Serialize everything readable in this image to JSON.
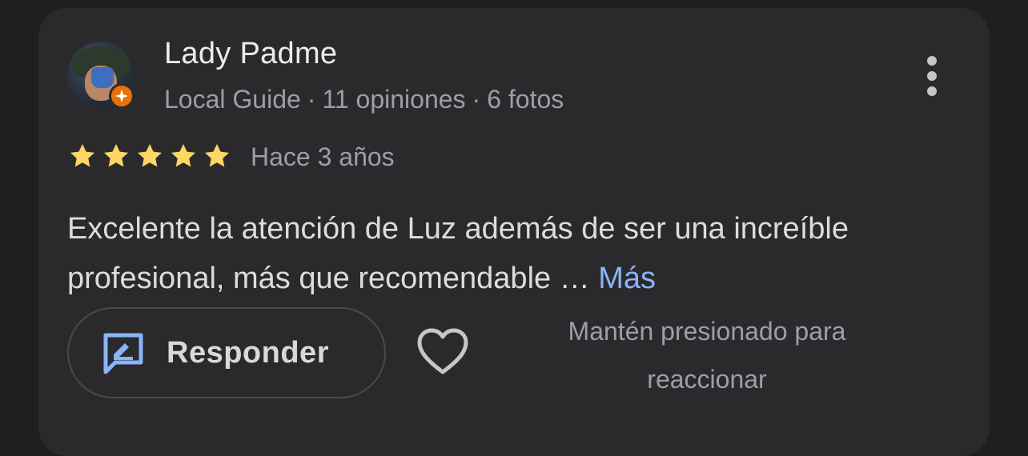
{
  "reviewer": {
    "name": "Lady Padme",
    "badge": "Local Guide",
    "reviews_count": "11 opiniones",
    "photos_count": "6 fotos",
    "separator": "·"
  },
  "rating": {
    "stars": 5,
    "max": 5,
    "color": "#fdd663"
  },
  "review": {
    "time": "Hace 3 años",
    "text_line1": "Excelente la atención de Luz además de ser una increíble",
    "text_line2": "profesional, más que recomendable …",
    "more_link": "Más"
  },
  "actions": {
    "reply_label": "Responder",
    "react_icon": "heart-outline-icon",
    "hint_line1": "Mantén presionado para",
    "hint_line2": "reaccionar"
  },
  "colors": {
    "background": "#1f1f21",
    "card": "#2a2a2d",
    "link": "#8ab4f8",
    "reply_icon": "#8ab4f8",
    "local_guide_badge": "#e8710a"
  }
}
